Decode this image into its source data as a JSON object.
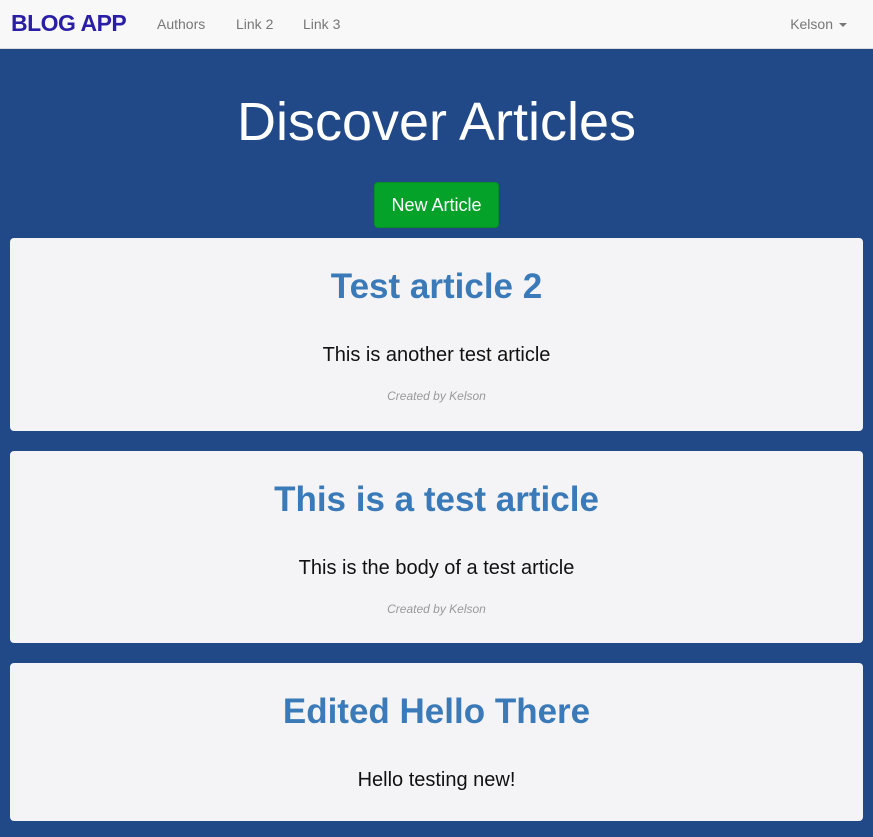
{
  "nav": {
    "brand": "BLOG APP",
    "links": [
      "Authors",
      "Link 2",
      "Link 3"
    ],
    "user": "Kelson"
  },
  "page": {
    "title": "Discover Articles",
    "new_button": "New Article"
  },
  "articles": [
    {
      "title": "Test article 2",
      "body": "This is another test article",
      "meta": "Created by Kelson"
    },
    {
      "title": "This is a test article",
      "body": "This is the body of a test article",
      "meta": "Created by Kelson"
    },
    {
      "title": "Edited Hello There",
      "body": "Hello testing new!"
    }
  ],
  "colors": {
    "background": "#214887",
    "brand": "#2a1ea6",
    "title_link": "#3a7ab8",
    "button": "#05a22a"
  }
}
